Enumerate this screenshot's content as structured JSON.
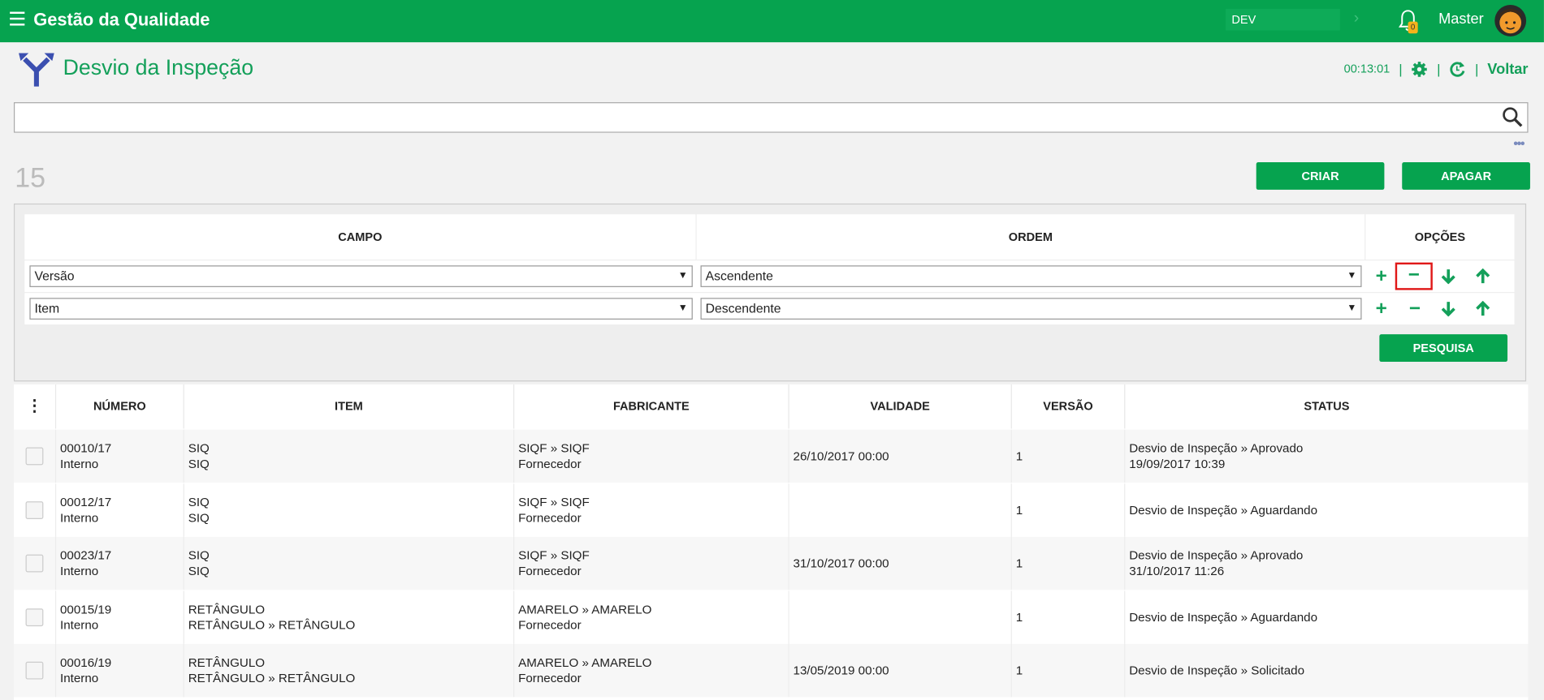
{
  "header": {
    "app_title": "Gestão da Qualidade",
    "env_label": "DEV",
    "notification_count": "0",
    "user_name": "Master"
  },
  "page": {
    "title": "Desvio da Inspeção",
    "timer": "00:13:01",
    "back_label": "Voltar"
  },
  "search": {
    "value": "",
    "placeholder": ""
  },
  "record_count": "15",
  "buttons": {
    "create": "CRIAR",
    "delete": "APAGAR",
    "search": "PESQUISA"
  },
  "sort": {
    "headers": {
      "field": "CAMPO",
      "order": "ORDEM",
      "options": "OPÇÕES"
    },
    "rows": [
      {
        "field": "Versão",
        "order": "Ascendente"
      },
      {
        "field": "Item",
        "order": "Descendente"
      }
    ]
  },
  "grid": {
    "menu_icon": "⋮",
    "columns": [
      "NÚMERO",
      "ITEM",
      "FABRICANTE",
      "VALIDADE",
      "VERSÃO",
      "STATUS"
    ],
    "rows": [
      {
        "numero": "00010/17",
        "numero2": "Interno",
        "item": "SIQ",
        "item2": "SIQ",
        "fab": "SIQF » SIQF",
        "fab2": "Fornecedor",
        "validade": "26/10/2017 00:00",
        "versao": "1",
        "status": "Desvio de Inspeção » Aprovado",
        "status2": "19/09/2017 10:39"
      },
      {
        "numero": "00012/17",
        "numero2": "Interno",
        "item": "SIQ",
        "item2": "SIQ",
        "fab": "SIQF » SIQF",
        "fab2": "Fornecedor",
        "validade": "",
        "versao": "1",
        "status": "Desvio de Inspeção » Aguardando",
        "status2": ""
      },
      {
        "numero": "00023/17",
        "numero2": "Interno",
        "item": "SIQ",
        "item2": "SIQ",
        "fab": "SIQF » SIQF",
        "fab2": "Fornecedor",
        "validade": "31/10/2017 00:00",
        "versao": "1",
        "status": "Desvio de Inspeção » Aprovado",
        "status2": "31/10/2017 11:26"
      },
      {
        "numero": "00015/19",
        "numero2": "Interno",
        "item": "RETÂNGULO",
        "item2": "RETÂNGULO » RETÂNGULO",
        "fab": "AMARELO » AMARELO",
        "fab2": "Fornecedor",
        "validade": "",
        "versao": "1",
        "status": "Desvio de Inspeção » Aguardando",
        "status2": ""
      },
      {
        "numero": "00016/19",
        "numero2": "Interno",
        "item": "RETÂNGULO",
        "item2": "RETÂNGULO » RETÂNGULO",
        "fab": "AMARELO » AMARELO",
        "fab2": "Fornecedor",
        "validade": "13/05/2019 00:00",
        "versao": "1",
        "status": "Desvio de Inspeção » Solicitado",
        "status2": ""
      }
    ]
  },
  "colors": {
    "brand": "#06a34f",
    "accent_text": "#14a05a",
    "highlight": "#e01818"
  }
}
